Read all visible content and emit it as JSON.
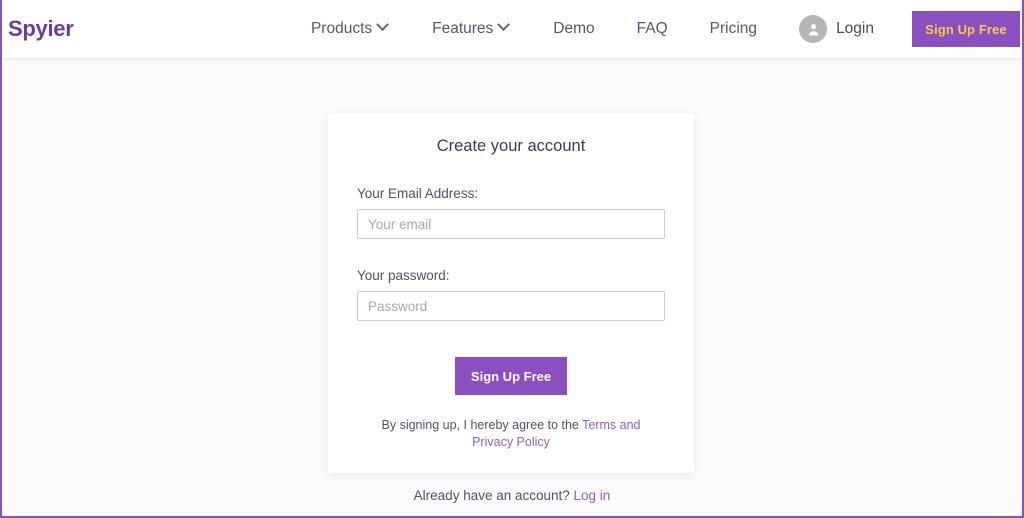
{
  "brand": {
    "name": "Spyier"
  },
  "header": {
    "nav": [
      {
        "label": "Products",
        "has_dropdown": true,
        "icon": "chevron-down-icon"
      },
      {
        "label": "Features",
        "has_dropdown": true,
        "icon": "chevron-down-icon"
      },
      {
        "label": "Demo",
        "has_dropdown": false
      },
      {
        "label": "FAQ",
        "has_dropdown": false
      },
      {
        "label": "Pricing",
        "has_dropdown": false
      }
    ],
    "login": {
      "label": "Login",
      "icon": "user-avatar-icon"
    },
    "signup_button": {
      "label": "Sign Up Free"
    }
  },
  "card": {
    "title": "Create your account",
    "email": {
      "label": "Your Email Address:",
      "placeholder": "Your email",
      "value": ""
    },
    "password": {
      "label": "Your password:",
      "placeholder": "Password",
      "value": ""
    },
    "submit_button": {
      "label": "Sign Up Free"
    },
    "terms": {
      "prefix": "By signing up, I hereby agree to the ",
      "link": "Terms and Privacy Policy"
    }
  },
  "footer": {
    "have_account_text": "Already have an account? ",
    "login_link": "Log in"
  },
  "colors": {
    "brand_purple": "#6d3b9e",
    "accent_purple": "#8b4fc0",
    "link_purple": "#8b5fcf",
    "button_text_gold": "#f7c948",
    "page_background": "#fbfbfc",
    "border_purple": "#8b4fc0"
  }
}
